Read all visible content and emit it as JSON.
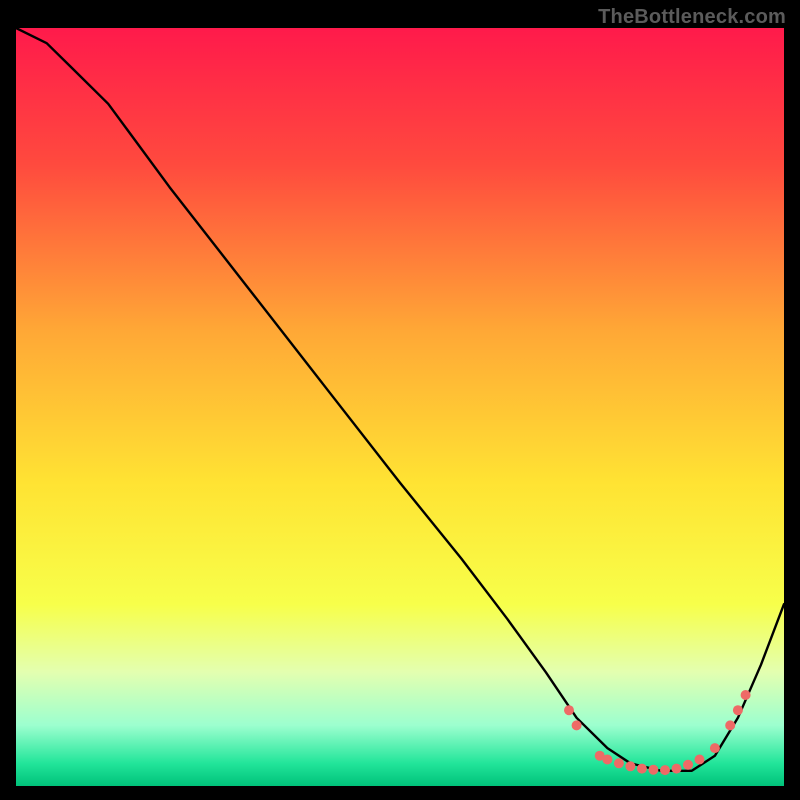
{
  "watermark": "TheBottleneck.com",
  "chart_data": {
    "type": "line",
    "title": "",
    "xlabel": "",
    "ylabel": "",
    "xlim": [
      0,
      100
    ],
    "ylim": [
      0,
      100
    ],
    "gradient_stops": [
      {
        "offset": 0,
        "color": "#ff1a4b"
      },
      {
        "offset": 18,
        "color": "#ff4a3e"
      },
      {
        "offset": 40,
        "color": "#ffa836"
      },
      {
        "offset": 60,
        "color": "#ffe333"
      },
      {
        "offset": 76,
        "color": "#f7ff4a"
      },
      {
        "offset": 85,
        "color": "#e3ffb0"
      },
      {
        "offset": 92,
        "color": "#9cffcf"
      },
      {
        "offset": 97,
        "color": "#22e59a"
      },
      {
        "offset": 100,
        "color": "#00c27a"
      }
    ],
    "series": [
      {
        "name": "curve",
        "color": "#000000",
        "x": [
          0,
          4,
          7,
          12,
          20,
          30,
          40,
          50,
          58,
          64,
          69,
          73,
          77,
          80,
          84,
          88,
          91,
          94,
          97,
          100
        ],
        "y": [
          100,
          98,
          95,
          90,
          79,
          66,
          53,
          40,
          30,
          22,
          15,
          9,
          5,
          3,
          2,
          2,
          4,
          9,
          16,
          24
        ]
      }
    ],
    "markers": {
      "name": "highlight-points",
      "color": "#ee6a66",
      "radius": 5,
      "points": [
        {
          "x": 72,
          "y": 10
        },
        {
          "x": 73,
          "y": 8
        },
        {
          "x": 76,
          "y": 4
        },
        {
          "x": 77,
          "y": 3.5
        },
        {
          "x": 78.5,
          "y": 3
        },
        {
          "x": 80,
          "y": 2.6
        },
        {
          "x": 81.5,
          "y": 2.3
        },
        {
          "x": 83,
          "y": 2.15
        },
        {
          "x": 84.5,
          "y": 2.1
        },
        {
          "x": 86,
          "y": 2.3
        },
        {
          "x": 87.5,
          "y": 2.8
        },
        {
          "x": 89,
          "y": 3.5
        },
        {
          "x": 91,
          "y": 5
        },
        {
          "x": 93,
          "y": 8
        },
        {
          "x": 94,
          "y": 10
        },
        {
          "x": 95,
          "y": 12
        }
      ]
    }
  }
}
